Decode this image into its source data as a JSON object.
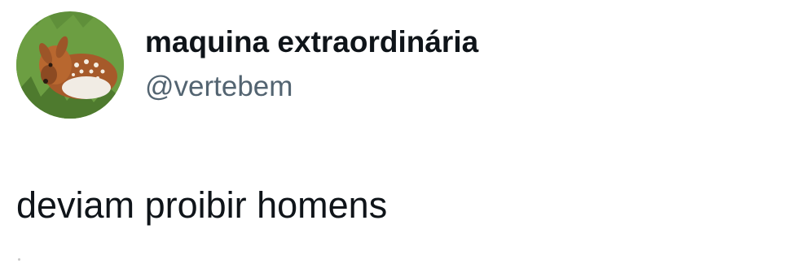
{
  "tweet": {
    "author": {
      "display_name": "maquina extraordinária",
      "handle": "@vertebem",
      "avatar_icon": "fawn-avatar"
    },
    "text": "deviam proibir homens"
  },
  "colors": {
    "primary_text": "#0f1419",
    "secondary_text": "#536471",
    "background": "#ffffff"
  }
}
